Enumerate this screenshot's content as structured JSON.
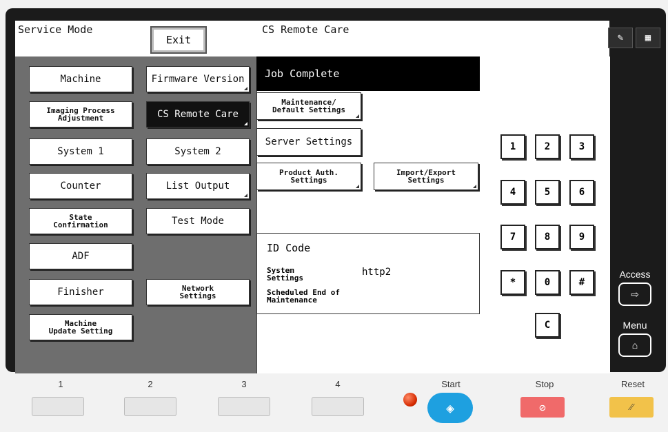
{
  "header": {
    "left_title": "Service Mode",
    "exit_label": "Exit",
    "right_title": "CS Remote Care"
  },
  "left_menu": [
    {
      "label": "Machine"
    },
    {
      "label": "Firmware Version"
    },
    {
      "label": "Imaging Process\nAdjustment"
    },
    {
      "label": "CS Remote Care",
      "selected": true
    },
    {
      "label": "System 1"
    },
    {
      "label": "System 2"
    },
    {
      "label": "Counter"
    },
    {
      "label": "List Output"
    },
    {
      "label": "State\nConfirmation"
    },
    {
      "label": "Test Mode"
    },
    {
      "label": "ADF"
    },
    {
      "label": "Finisher"
    },
    {
      "label": "Network\nSettings"
    },
    {
      "label": "Machine\nUpdate Setting"
    }
  ],
  "status": {
    "job": "Job Complete"
  },
  "right_buttons": {
    "maintenance": "Maintenance/\nDefault Settings",
    "server": "Server Settings",
    "product_auth": "Product Auth.\nSettings",
    "import_export": "Import/Export\nSettings"
  },
  "id_panel": {
    "title": "ID Code",
    "system_settings_label": "System\nSettings",
    "system_settings_value": "http2",
    "scheduled_end_label": "Scheduled End of\nMaintenance"
  },
  "keypad": [
    "1",
    "2",
    "3",
    "4",
    "5",
    "6",
    "7",
    "8",
    "9",
    "*",
    "0",
    "#",
    "C"
  ],
  "side": {
    "access_label": "Access",
    "menu_label": "Menu"
  },
  "hardware": {
    "keys": [
      "1",
      "2",
      "3",
      "4"
    ],
    "start_label": "Start",
    "stop_label": "Stop",
    "reset_label": "Reset"
  },
  "colors": {
    "start": "#1ea0e0",
    "stop": "#f06a6a",
    "reset": "#f2c24a",
    "selected": "#111111",
    "left_panel": "#6e6e6e"
  }
}
